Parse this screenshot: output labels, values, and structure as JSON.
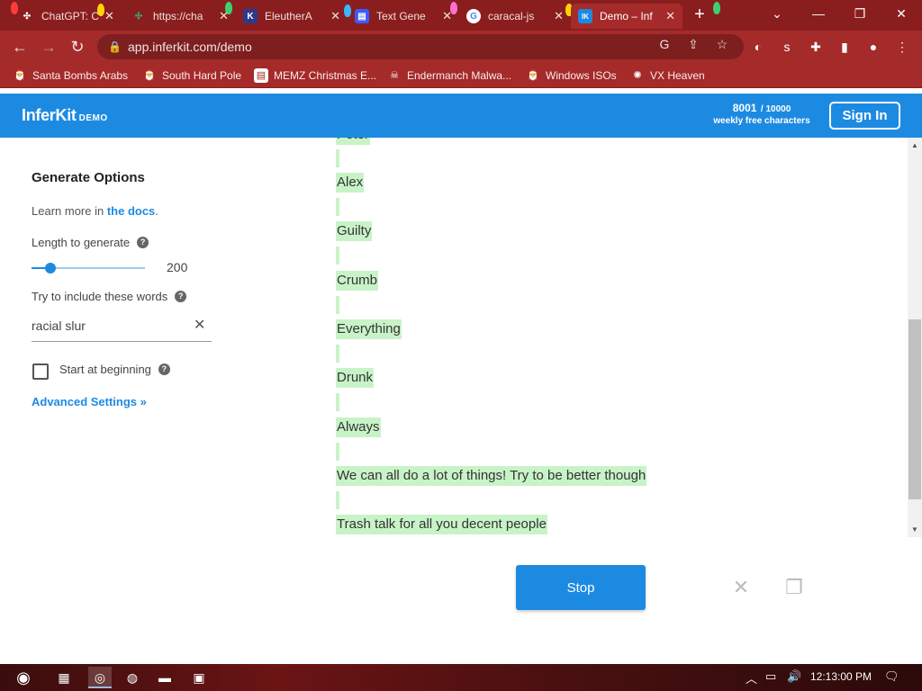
{
  "browser": {
    "tabs": [
      {
        "label": "ChatGPT: C",
        "icon": "openai-icon",
        "icon_char": "✣",
        "icon_color": "#2a2a2a"
      },
      {
        "label": "https://cha",
        "icon": "openai-icon",
        "icon_char": "✣",
        "icon_color": "#3aa57a"
      },
      {
        "label": "EleutherA",
        "icon": "eleuther-icon",
        "icon_char": "K",
        "icon_color": "#2d3a8c"
      },
      {
        "label": "Text Gene",
        "icon": "text-gen-icon",
        "icon_char": "▤",
        "icon_color": "#3d5afe"
      },
      {
        "label": "caracal-js",
        "icon": "google-icon",
        "icon_char": "G",
        "icon_color": "#ffffff"
      },
      {
        "label": "Demo – Inf",
        "icon": "inferkit-icon",
        "icon_char": "IK",
        "icon_color": "#1d8ae2"
      }
    ],
    "url": "app.inferkit.com/demo",
    "bookmarks": [
      {
        "label": "Santa Bombs Arabs",
        "icon": "santa-icon",
        "icon_char": "🎅"
      },
      {
        "label": "South Hard Pole",
        "icon": "santa-icon",
        "icon_char": "🎅"
      },
      {
        "label": "MEMZ Christmas E...",
        "icon": "page-icon",
        "icon_char": "▤"
      },
      {
        "label": "Endermanch Malwa...",
        "icon": "skull-icon",
        "icon_char": "☠"
      },
      {
        "label": "Windows ISOs",
        "icon": "santa-icon",
        "icon_char": "🎅"
      },
      {
        "label": "VX Heaven",
        "icon": "virus-icon",
        "icon_char": "✺"
      }
    ]
  },
  "app": {
    "logo": "InferKit",
    "logo_badge": "DEMO",
    "credits_used": "8001",
    "credits_total": "/ 10000",
    "credits_label": "weekly free characters",
    "signin_label": "Sign In"
  },
  "options": {
    "heading": "Generate Options",
    "learn_prefix": "Learn more in ",
    "learn_link": "the docs",
    "learn_suffix": ".",
    "length_label": "Length to generate",
    "length_value": "200",
    "length_min": 0,
    "length_max": 2000,
    "length_number": 200,
    "words_label": "Try to include these words",
    "words_value": "racial slur",
    "start_label": "Start at beginning",
    "advanced_label": "Advanced Settings »"
  },
  "output": {
    "partial_top": "Peter",
    "lines": [
      "Alex",
      "Guilty",
      "Crumb",
      "Everything",
      "Drunk",
      "Always",
      "We can all do a lot of things! Try to be better though",
      "Trash talk for all you decent people"
    ]
  },
  "actions": {
    "stop_label": "Stop"
  },
  "taskbar": {
    "time": "12:13:00 PM"
  },
  "colors": {
    "brand": "#1d8ae2",
    "highlight": "#c8f3c8",
    "browser_frame": "#a52a2a"
  }
}
